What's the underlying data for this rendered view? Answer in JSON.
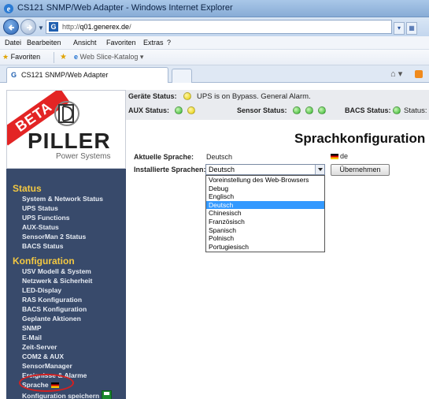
{
  "window": {
    "title": "CS121 SNMP/Web Adapter - Windows Internet Explorer"
  },
  "address": {
    "url_prefix": "http://",
    "url_host": "q01.generex.de",
    "url_suffix": "/"
  },
  "menu": [
    "Datei",
    "Bearbeiten",
    "Ansicht",
    "Favoriten",
    "Extras",
    "?"
  ],
  "favorites": {
    "label": "Favoriten",
    "web_slice": "Web Slice-Katalog ▾"
  },
  "tab": {
    "label": "CS121 SNMP/Web Adapter"
  },
  "logo": {
    "badge": "BETA",
    "brand": "PILLER",
    "tagline": "Power Systems"
  },
  "status_bar": {
    "geraete_label": "Geräte Status:",
    "geraete_text": "UPS is on Bypass. General Alarm.",
    "aux_label": "AUX Status:",
    "sensor_label": "Sensor Status:",
    "bacs_label": "BACS Status:",
    "bacs_text": "Status:"
  },
  "sidebar": {
    "status_heading": "Status",
    "status_items": [
      "System & Network Status",
      "UPS Status",
      "UPS Functions",
      "AUX-Status",
      "SensorMan 2 Status",
      "BACS Status"
    ],
    "config_heading": "Konfiguration",
    "config_items": [
      "USV Modell & System",
      "Netzwerk & Sicherheit",
      "LED-Display",
      "RAS Konfiguration",
      "BACS Konfiguration",
      "Geplante Aktionen",
      "SNMP",
      "E-Mail",
      "Zeit-Server",
      "COM2 & AUX",
      "SensorManager",
      "Ereignisse & Alarme",
      "Sprache",
      "Konfiguration speichern"
    ]
  },
  "main": {
    "title": "Sprachkonfiguration",
    "current_label": "Aktuelle Sprache:",
    "current_value": "Deutsch",
    "current_code": "de",
    "installed_label": "Installierte Sprachen:",
    "selected": "Deutsch",
    "apply_label": "Übernehmen",
    "options": [
      "Voreinstellung des Web-Browsers",
      "Debug",
      "Englisch",
      "Deutsch",
      "Chinesisch",
      "Französisch",
      "Spanisch",
      "Polnisch",
      "Portugiesisch"
    ],
    "selected_index": 3
  },
  "colors": {
    "sidebar_bg": "#384a6b",
    "section_heading": "#f3c842",
    "highlight": "#3399ff",
    "annotation_ring": "#d42020"
  }
}
